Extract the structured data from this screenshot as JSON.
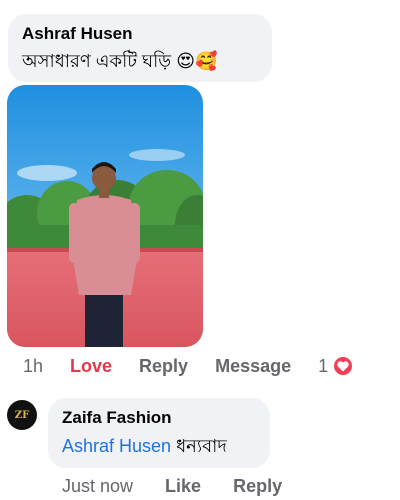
{
  "comment": {
    "author": "Ashraf Husen",
    "text": "অসাধারণ একটি ঘড়ি",
    "emojis": "😍🥰"
  },
  "comment_actions": {
    "time": "1h",
    "love_label": "Love",
    "reply_label": "Reply",
    "message_label": "Message",
    "reaction_count": "1",
    "reaction_icon": "heart-icon"
  },
  "reply": {
    "author": "Zaifa Fashion",
    "avatar_text": "ZF",
    "mention": "Ashraf Husen",
    "text": "ধন্যবাদ"
  },
  "reply_actions": {
    "time": "Just now",
    "like_label": "Like",
    "reply_label": "Reply"
  },
  "colors": {
    "bubble": "#f0f2f5",
    "love": "#e0394b",
    "mention": "#1b74e4",
    "heart": "#f33e58"
  }
}
